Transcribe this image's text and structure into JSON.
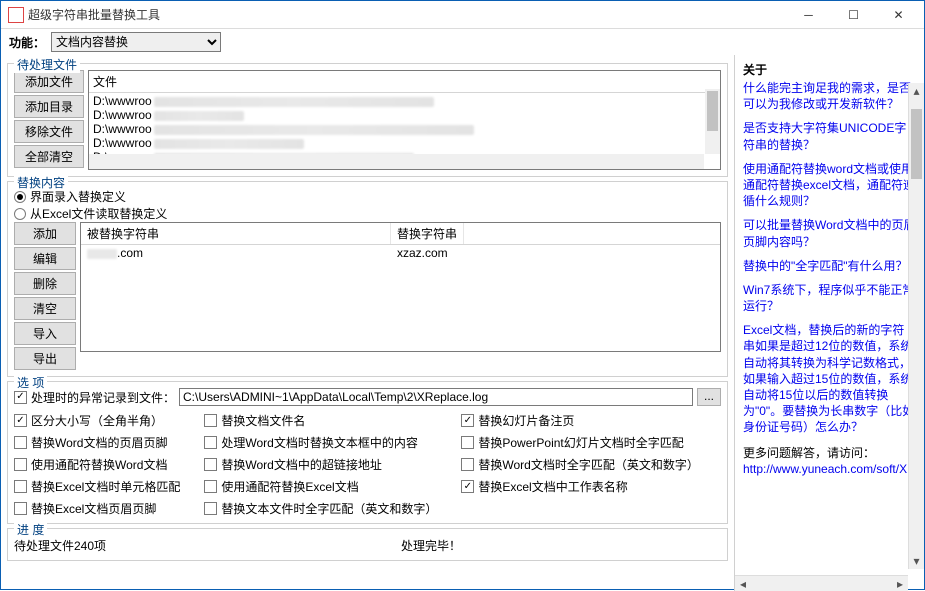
{
  "window": {
    "title": "超级字符串批量替换工具"
  },
  "func": {
    "label": "功能：",
    "selected": "文档内容替换"
  },
  "filesGroup": {
    "legend": "待处理文件",
    "addFile": "添加文件",
    "addDir": "添加目录",
    "removeFile": "移除文件",
    "clearAll": "全部清空",
    "colFile": "文件",
    "rows": [
      "D:\\wwwroo",
      "D:\\wwwroo",
      "D:\\wwwroo",
      "D:\\wwwroo",
      "D:\\wwwroo"
    ]
  },
  "replGroup": {
    "legend": "替换内容",
    "radioUI": "界面录入替换定义",
    "radioExcel": "从Excel文件读取替换定义",
    "add": "添加",
    "edit": "编辑",
    "del": "删除",
    "clear": "清空",
    "import": "导入",
    "export": "导出",
    "colFrom": "被替换字符串",
    "colTo": "替换字符串",
    "fromVal": ".com",
    "toVal": "xzaz.com"
  },
  "optGroup": {
    "legend": "选 项",
    "logChkLabel": "处理时的异常记录到文件：",
    "logPath": "C:\\Users\\ADMINI~1\\AppData\\Local\\Temp\\2\\XReplace.log",
    "col1": [
      {
        "label": "区分大小写（全角半角）",
        "on": true
      },
      {
        "label": "替换Word文档的页眉页脚",
        "on": false
      },
      {
        "label": "使用通配符替换Word文档",
        "on": false
      },
      {
        "label": "替换Excel文档时单元格匹配",
        "on": false
      },
      {
        "label": "替换Excel文档页眉页脚",
        "on": false
      }
    ],
    "col2": [
      {
        "label": "替换文档文件名",
        "on": false
      },
      {
        "label": "处理Word文档时替换文本框中的内容",
        "on": false
      },
      {
        "label": "替换Word文档中的超链接地址",
        "on": false
      },
      {
        "label": "使用通配符替换Excel文档",
        "on": false
      },
      {
        "label": "替换文本文件时全字匹配（英文和数字）",
        "on": false
      }
    ],
    "col3": [
      {
        "label": "替换幻灯片备注页",
        "on": true
      },
      {
        "label": "替换PowerPoint幻灯片文档时全字匹配",
        "on": false
      },
      {
        "label": "替换Word文档时全字匹配（英文和数字）",
        "on": false
      },
      {
        "label": "替换Excel文档中工作表名称",
        "on": true
      }
    ]
  },
  "progGroup": {
    "legend": "进 度",
    "pending": "待处理文件240项",
    "done": "处理完毕！"
  },
  "about": {
    "title": "关于",
    "links": [
      "什么能完主询足我的需求，是否可以为我修改或开发新软件？",
      "是否支持大字符集UNICODE字符串的替换？",
      "使用通配符替换word文档或使用通配符替换excel文档，通配符遵循什么规则？",
      "可以批量替换Word文档中的页眉页脚内容吗？",
      "替换中的\"全字匹配\"有什么用？",
      "Win7系统下，程序似乎不能正常运行？",
      "Excel文档，替换后的新的字符串如果是超过12位的数值，系统自动将其转换为科学记数格式，如果输入超过15位的数值，系统自动将15位以后的数值转换为\"0\"。要替换为长串数字（比如身份证号码）怎么办？"
    ],
    "moreText": "更多问题解答，请访问：",
    "moreUrl": "http://www.yuneach.com/soft/X"
  }
}
